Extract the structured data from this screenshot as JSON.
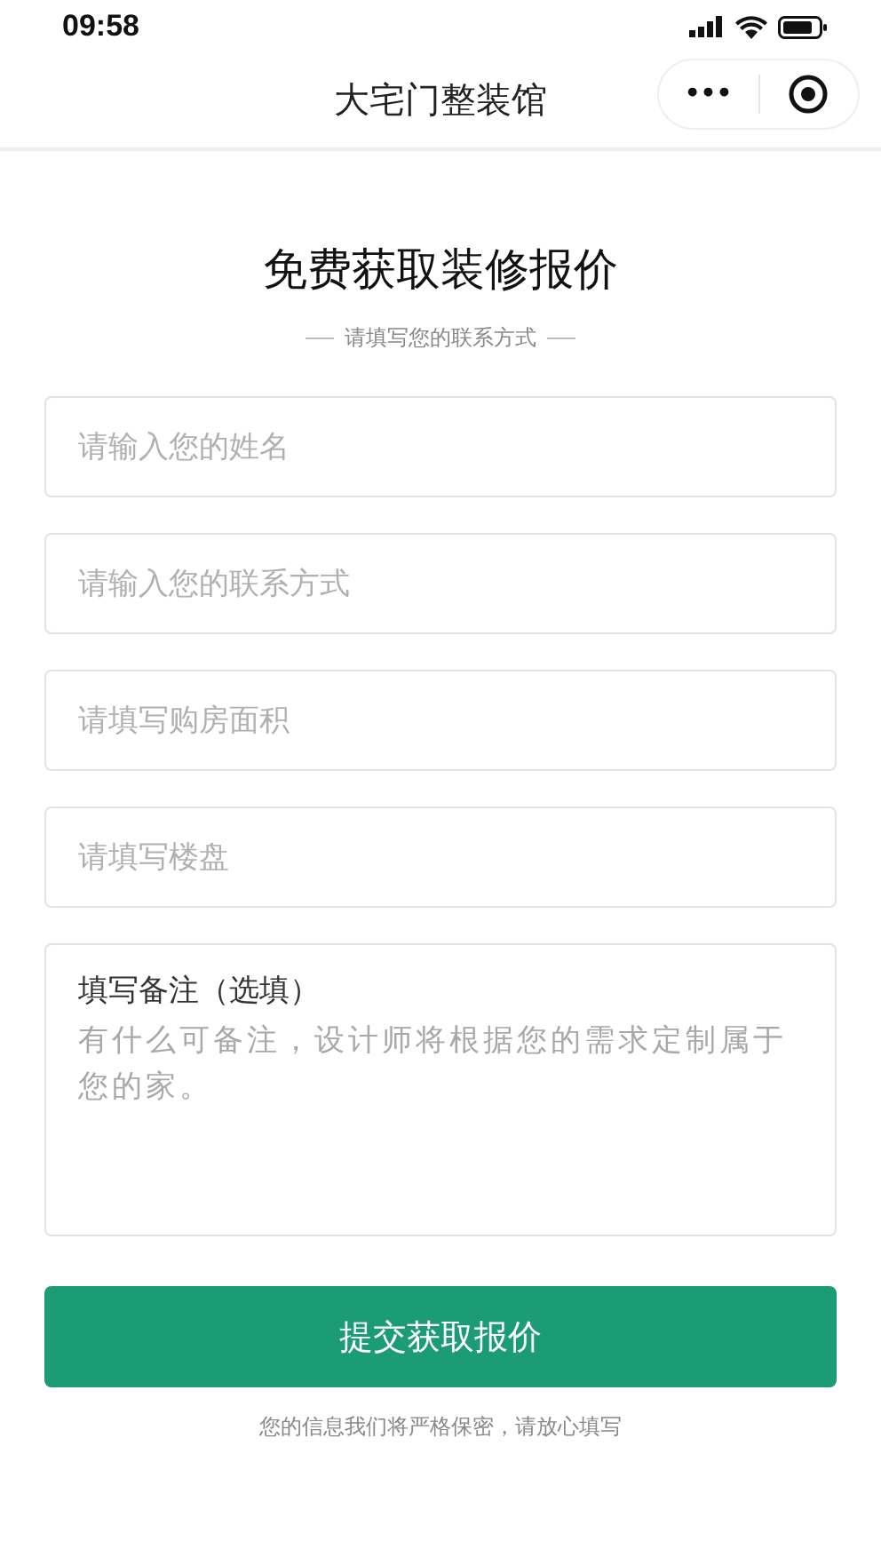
{
  "status_bar": {
    "time": "09:58"
  },
  "nav_bar": {
    "title": "大宅门整装馆",
    "more": "•••"
  },
  "form": {
    "title": "免费获取装修报价",
    "subtitle": "请填写您的联系方式",
    "fields": [
      {
        "placeholder": "请输入您的姓名"
      },
      {
        "placeholder": "请输入您的联系方式"
      },
      {
        "placeholder": "请填写购房面积"
      },
      {
        "placeholder": "请填写楼盘"
      }
    ],
    "remark": {
      "label": "填写备注（选填）",
      "placeholder": "有什么可备注，设计师将根据您的需求定制属于您的家。"
    },
    "submit": "提交获取报价",
    "note": "您的信息我们将严格保密，请放心填写"
  }
}
